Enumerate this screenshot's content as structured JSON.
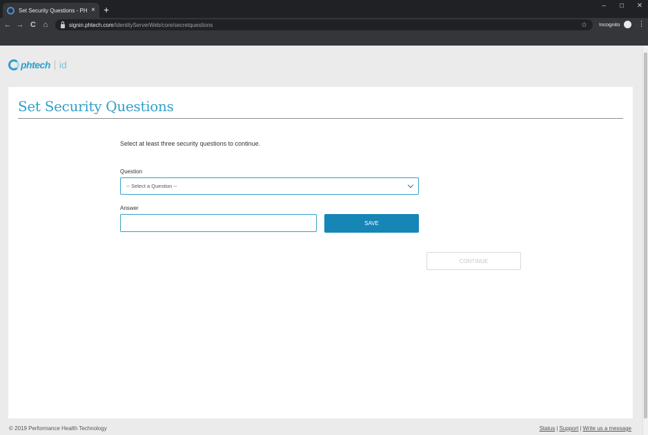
{
  "browser": {
    "tab_title": "Set Security Questions - PH Tech",
    "tab_close": "×",
    "new_tab": "+",
    "url_host": "signin.phtech.com",
    "url_path": "/IdentityServerWeb/core/secretquestions",
    "incognito_label": "Incognito",
    "nav": {
      "back": "←",
      "forward": "→",
      "reload": "C",
      "home": "⌂"
    },
    "window_controls": {
      "minimize": "–",
      "maximize": "☐",
      "close": "✕"
    },
    "star": "☆",
    "menu": "⋮"
  },
  "logo": {
    "brand": "phtech",
    "suffix": "id"
  },
  "page": {
    "title": "Set Security Questions",
    "instruction": "Select at least three security questions to continue.",
    "question_label": "Question",
    "question_selected": "-- Select a Question --",
    "answer_label": "Answer",
    "answer_value": "",
    "save_label": "SAVE",
    "continue_label": "CONTINUE"
  },
  "footer": {
    "copyright": "© 2019 Performance Health Technology",
    "links": [
      "Status",
      "Support",
      "Write us a message"
    ],
    "separator": "|"
  },
  "colors": {
    "accent": "#2f9fcb",
    "button": "#1586b6",
    "chrome_dark": "#202124",
    "chrome_toolbar": "#35363a"
  }
}
